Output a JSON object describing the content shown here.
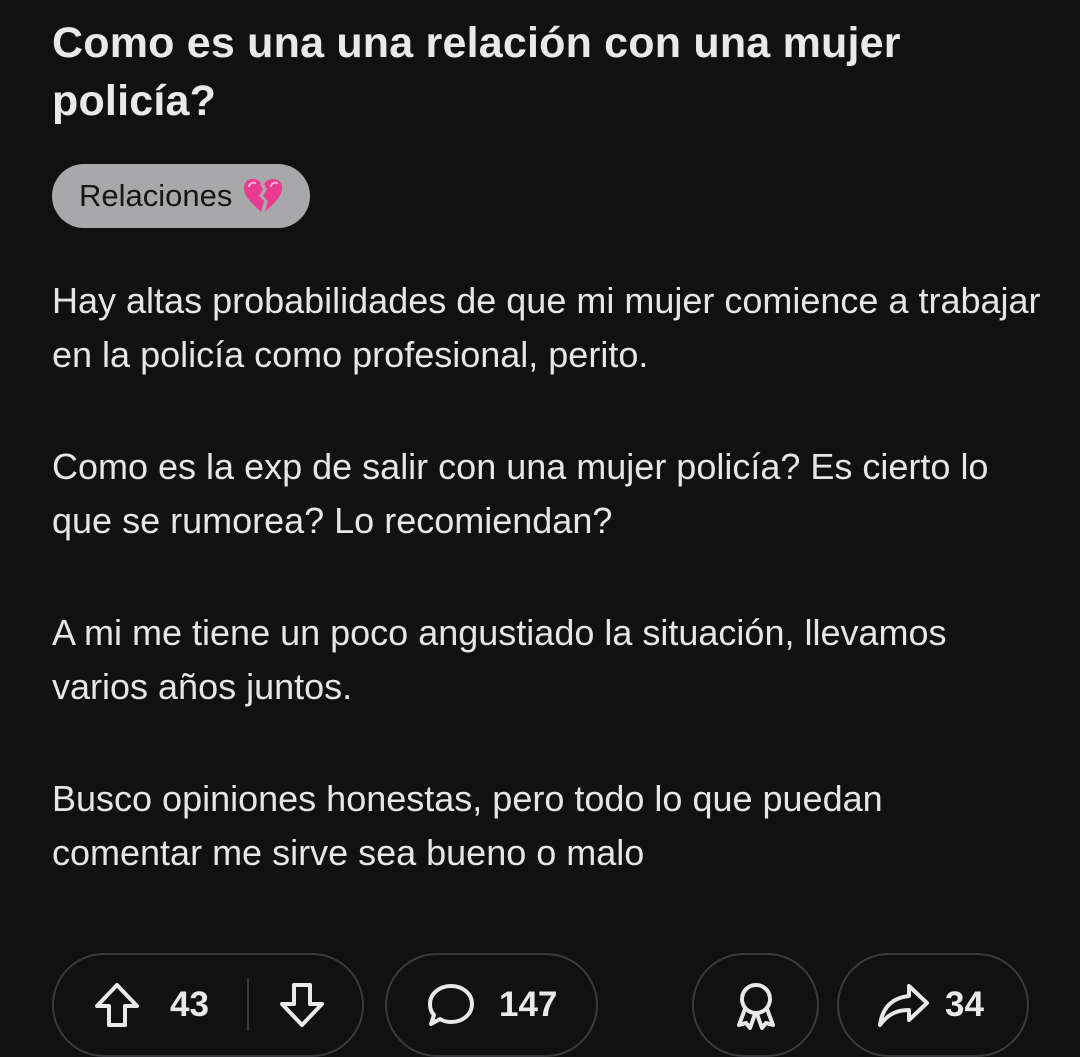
{
  "post": {
    "title": "Como es una una relación con una mujer policía?",
    "flair": {
      "label": "Relaciones",
      "emoji": "broken-heart-icon",
      "background": "#a8a8aa"
    },
    "paragraphs": [
      "Hay altas probabilidades de que mi mujer comience a trabajar en la policía como profesional, perito.",
      "Como es la exp de salir con una mujer policía? Es cierto lo que se rumorea? Lo recomiendan?",
      "A mi me tiene un poco angustiado la situación, llevamos varios años juntos.",
      "Busco opiniones honestas, pero todo lo que puedan comentar me sirve sea bueno o malo"
    ]
  },
  "actions": {
    "upvote": {
      "icon": "upvote-arrow-icon",
      "count": "43"
    },
    "downvote": {
      "icon": "downvote-arrow-icon"
    },
    "comments": {
      "icon": "comment-bubble-icon",
      "count": "147"
    },
    "award": {
      "icon": "award-ribbon-icon"
    },
    "share": {
      "icon": "share-arrow-icon",
      "count": "34"
    }
  },
  "colors": {
    "background": "#111112",
    "text": "#e8e8ea",
    "pill_border": "#3b3b3e",
    "broken_heart": "#e93b8f"
  }
}
